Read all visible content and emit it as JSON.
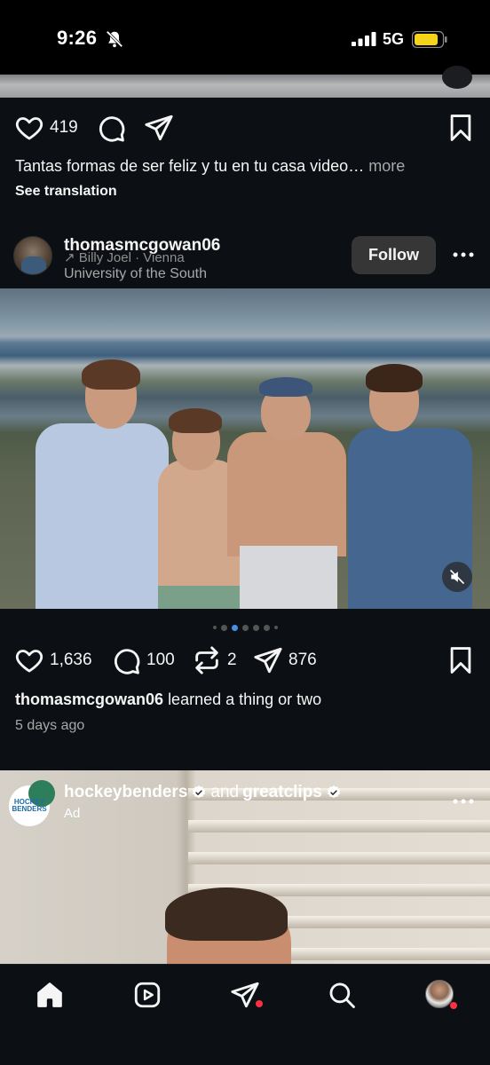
{
  "status_bar": {
    "time": "9:26",
    "network": "5G"
  },
  "previous_post": {
    "likes": "419",
    "caption": "Tantas formas de ser feliz y tu en tu casa video…",
    "more_label": "more",
    "see_translation": "See translation"
  },
  "post": {
    "username": "thomasmcgowan06",
    "music": "Billy Joel · Vienna",
    "location": "University of the South",
    "follow_label": "Follow",
    "likes": "1,636",
    "comments": "100",
    "reposts": "2",
    "shares": "876",
    "caption_user": "thomasmcgowan06",
    "caption_text": "learned a thing or two",
    "timestamp": "5 days ago",
    "carousel": {
      "count": 7,
      "active_index": 2
    }
  },
  "ad": {
    "user1": "hockeybenders",
    "joiner": "and",
    "user2": "greatclips",
    "label": "Ad",
    "avatar_text": "HOCKEY BENDERS"
  },
  "tab_bar": {
    "items": [
      "home-icon",
      "reels-icon",
      "direct-icon",
      "search-icon",
      "profile-avatar"
    ]
  },
  "colors": {
    "background": "#0c1014",
    "follow_button": "#363636",
    "accent_red": "#ff3040",
    "dot_active": "#4a90e2"
  }
}
